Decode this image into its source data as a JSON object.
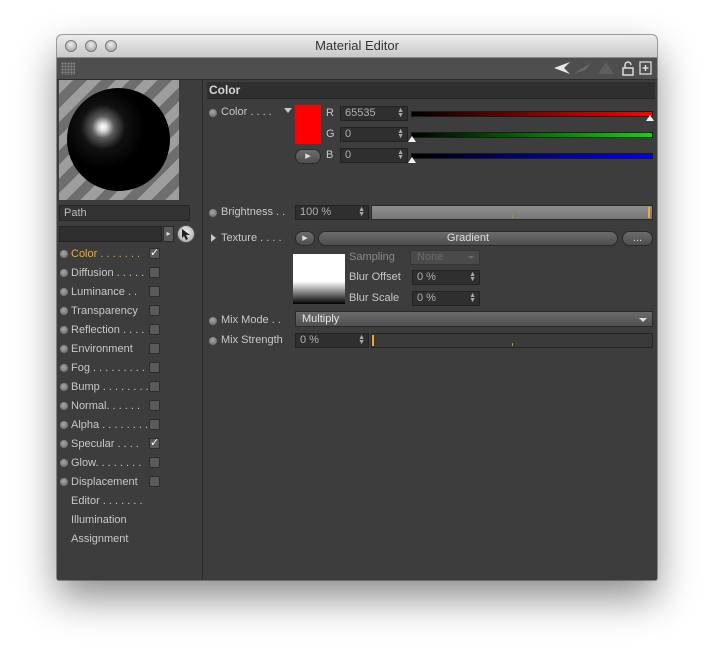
{
  "window": {
    "title": "Material Editor"
  },
  "left": {
    "path_label": "Path",
    "channels": [
      {
        "label": "Color . . . . . . .",
        "checked": true,
        "active": true,
        "check_mark": "✓"
      },
      {
        "label": "Diffusion . . . . .",
        "checked": false
      },
      {
        "label": "Luminance . .",
        "checked": false
      },
      {
        "label": "Transparency",
        "checked": false
      },
      {
        "label": "Reflection . . . .",
        "checked": false
      },
      {
        "label": "Environment",
        "checked": false
      },
      {
        "label": "Fog . . . . . . . . .",
        "checked": false
      },
      {
        "label": "Bump . . . . . . . .",
        "checked": false
      },
      {
        "label": "Normal. . . . . .",
        "checked": false
      },
      {
        "label": "Alpha . . . . . . . .",
        "checked": false
      },
      {
        "label": "Specular . . . .",
        "checked": true,
        "check_mark": "✓"
      },
      {
        "label": "Glow. . . . . . . .",
        "checked": false
      },
      {
        "label": "Displacement",
        "checked": false
      }
    ],
    "extras": [
      "Editor . . . . . . .",
      "Illumination",
      "Assignment"
    ]
  },
  "color_section": {
    "header": "Color",
    "color_label": "Color . . . .",
    "swatch_color": "#ff0000",
    "r_label": "R",
    "r_value": "65535",
    "g_label": "G",
    "g_value": "0",
    "b_label": "B",
    "b_value": "0",
    "brightness_label": "Brightness . .",
    "brightness_value": "100 %",
    "brightness_fraction": 1.0,
    "texture_label": "Texture . . . .",
    "texture_button": "Gradient",
    "texture_more": "...",
    "sampling_label": "Sampling",
    "sampling_value": "None",
    "blur_offset_label": "Blur Offset",
    "blur_offset_value": "0 %",
    "blur_scale_label": "Blur Scale",
    "blur_scale_value": "0 %",
    "mix_mode_label": "Mix Mode . .",
    "mix_mode_value": "Multiply",
    "mix_strength_label": "Mix Strength",
    "mix_strength_value": "0 %",
    "mix_strength_fraction": 0.0
  },
  "colors": {
    "active_channel": "#f0a830",
    "red": "#ff0000",
    "green": "#00e000",
    "blue": "#0000ff"
  }
}
